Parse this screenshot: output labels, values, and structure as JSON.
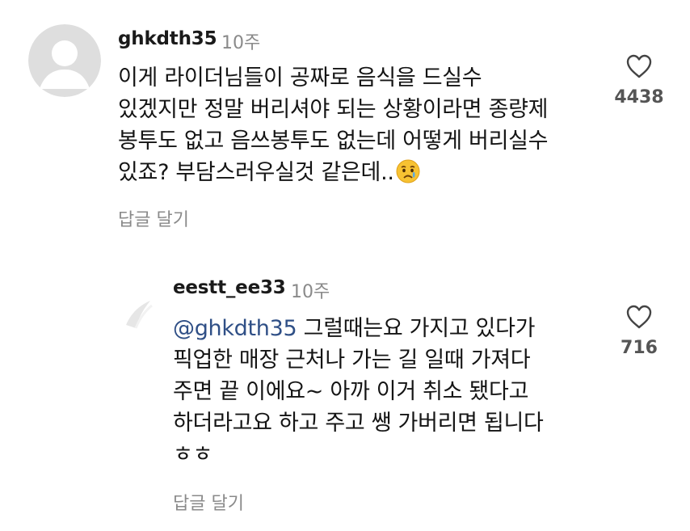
{
  "comments": [
    {
      "username": "ghkdth35",
      "time": "10주",
      "lines": [
        "이게 라이더님들이 공짜로 음식을 드실수",
        "있겠지만 정말 버리셔야 되는 상황이라면 종량제",
        "봉투도 없고 음쓰봉투도 없는데 어떻게 버리실수",
        "있죠? 부담스러우실것 같은데.."
      ],
      "emoji": "crying-face-emoji",
      "reply_label": "답글 달기",
      "like_count": "4438",
      "like_icon": "heart-outline-icon"
    },
    {
      "username": "eestt_ee33",
      "time": "10주",
      "mention": "@ghkdth35",
      "lines": [
        " 그럴때는요 가지고 있다가",
        "픽업한 매장 근처나 가는 길 일때 가져다",
        "주면 끝 이에요~ 아까 이거 취소 됐다고",
        "하더라고요 하고 주고 쌩 가버리면 됩니다",
        "ㅎㅎ"
      ],
      "reply_label": "답글 달기",
      "like_count": "716",
      "like_icon": "heart-outline-icon"
    }
  ],
  "colors": {
    "username": "#1a1a1a",
    "meta": "#8a8a8a",
    "mention": "#2f4f86",
    "avatar_bg": "#dcdcdc"
  }
}
